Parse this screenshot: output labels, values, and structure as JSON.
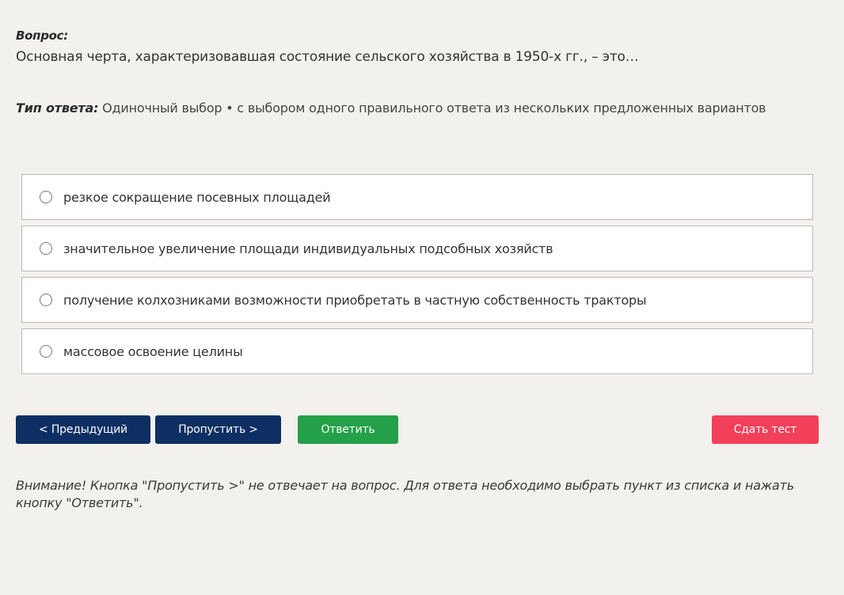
{
  "question": {
    "label": "Вопрос:",
    "text": "Основная черта, характеризовавшая состояние сельского хозяйства в 1950-х гг., – это…"
  },
  "answer_type": {
    "label": "Тип ответа:",
    "value": "Одиночный выбор • с выбором одного правильного ответа из нескольких предложенных вариантов"
  },
  "options": [
    {
      "label": "резкое сокращение посевных площадей",
      "selected": false
    },
    {
      "label": "значительное увеличение площади индивидуальных подсобных хозяйств",
      "selected": false
    },
    {
      "label": "получение колхозниками возможности приобретать в частную собственность тракторы",
      "selected": false
    },
    {
      "label": "массовое освоение целины",
      "selected": false
    }
  ],
  "buttons": {
    "prev": "< Предыдущий",
    "skip": "Пропустить >",
    "answer": "Ответить",
    "submit": "Сдать тест"
  },
  "notice": "Внимание! Кнопка \"Пропустить >\" не отвечает на вопрос. Для ответа необходимо выбрать пункт из списка и нажать кнопку \"Ответить\".",
  "colors": {
    "background": "#f2f1ed",
    "nav_button": "#0d2f63",
    "answer_button": "#24a048",
    "submit_button": "#f2405a"
  }
}
